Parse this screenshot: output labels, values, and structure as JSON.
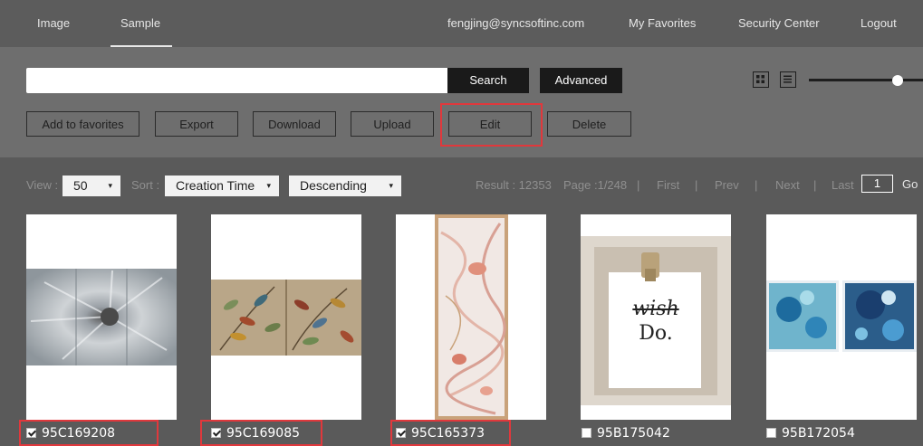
{
  "topnav": {
    "tabs": [
      {
        "label": "Image"
      },
      {
        "label": "Sample"
      }
    ],
    "user_email": "fengjing@syncsoftinc.com",
    "favorites": "My Favorites",
    "security": "Security Center",
    "logout": "Logout"
  },
  "search": {
    "placeholder": "",
    "value": "",
    "search_label": "Search",
    "advanced_label": "Advanced"
  },
  "view_icons": [
    "grid-view-icon",
    "list-view-icon"
  ],
  "slider": {
    "value": 0.8
  },
  "actions": {
    "add_to_favorites": "Add to favorites",
    "export": "Export",
    "download": "Download",
    "upload": "Upload",
    "edit": "Edit",
    "delete": "Delete"
  },
  "filters": {
    "view_label": "View :",
    "view_value": "50",
    "sort_label": "Sort :",
    "sort_field": "Creation Time",
    "sort_order": "Descending"
  },
  "pagination": {
    "result": "Result : 12353",
    "page": "Page :1/248",
    "sep": "|",
    "first": "First",
    "prev": "Prev",
    "next": "Next",
    "last": "Last",
    "current": "1",
    "go": "Go"
  },
  "items": [
    {
      "code": "95C169208",
      "checked": true
    },
    {
      "code": "95C169085",
      "checked": true
    },
    {
      "code": "95C165373",
      "checked": true
    },
    {
      "code": "95B175042",
      "checked": false,
      "art_text": "wish",
      "art_text2": "Do."
    },
    {
      "code": "95B172054",
      "checked": false
    }
  ],
  "colors": {
    "highlight": "#e0383c",
    "topbar": "#5c5c5c",
    "toolbar": "#6e6e6e",
    "background": "#5a5a5a"
  }
}
